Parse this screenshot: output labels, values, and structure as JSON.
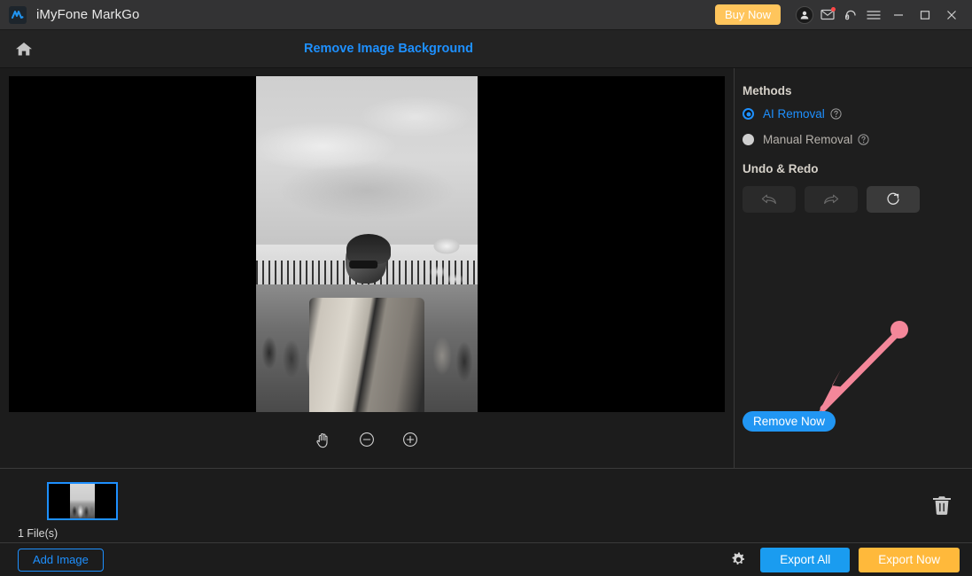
{
  "titlebar": {
    "app_name": "iMyFone MarkGo",
    "logo_icon": "markgo-logo-icon",
    "buy_now_label": "Buy Now",
    "account_icon": "account-avatar-icon",
    "mail_icon": "mail-icon",
    "support_icon": "headset-support-icon",
    "menu_icon": "hamburger-menu-icon",
    "minimize_icon": "minimize-icon",
    "maximize_icon": "maximize-icon",
    "close_icon": "close-icon"
  },
  "navbar": {
    "home_icon": "home-icon",
    "page_title": "Remove Image Background",
    "title_color": "#1e90ff"
  },
  "editor": {
    "zoom_tools": [
      {
        "name": "pan-hand-tool",
        "icon": "hand-icon"
      },
      {
        "name": "zoom-out-button",
        "icon": "minus-circle-icon"
      },
      {
        "name": "zoom-in-button",
        "icon": "plus-circle-icon"
      }
    ]
  },
  "panel": {
    "methods_heading": "Methods",
    "methods": [
      {
        "label": "AI Removal",
        "selected": true,
        "help_icon": "help-circle-icon"
      },
      {
        "label": "Manual Removal",
        "selected": false,
        "help_icon": "help-circle-icon"
      }
    ],
    "undo_redo_heading": "Undo & Redo",
    "undo_redo_buttons": [
      {
        "name": "undo-button",
        "icon": "undo-arrow-icon",
        "enabled": false
      },
      {
        "name": "redo-button",
        "icon": "redo-arrow-icon",
        "enabled": false
      },
      {
        "name": "reset-button",
        "icon": "refresh-icon",
        "enabled": true
      }
    ],
    "remove_now_label": "Remove Now",
    "remove_now_color": "#2196f3",
    "annotation_arrow_color": "#f4879a"
  },
  "filmstrip": {
    "file_count_label": "1 File(s)",
    "thumbnail_name": "image-thumbnail",
    "thumbnail_selected_color": "#1e90ff",
    "delete_icon": "trash-icon"
  },
  "bottombar": {
    "add_image_label": "Add Image",
    "settings_icon": "gear-icon",
    "export_all_label": "Export All",
    "export_now_label": "Export Now",
    "export_all_color": "#1a9cf0",
    "export_now_color": "#ffb93b"
  }
}
